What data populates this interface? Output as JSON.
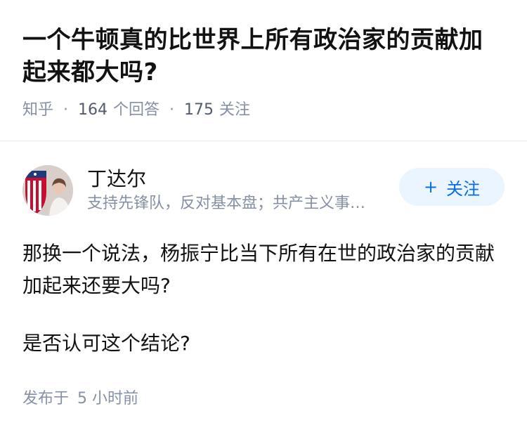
{
  "question": {
    "title": "一个牛顿真的比世界上所有政治家的贡献加起来都大吗?",
    "source": "知乎",
    "answer_count": "164",
    "answer_label": "个回答",
    "follow_count": "175",
    "follow_label": "关注"
  },
  "answer": {
    "author": {
      "name": "丁达尔",
      "bio": "支持先锋队，反对基本盘；共产主义事业的接班人"
    },
    "follow_button": {
      "icon": "plus-icon",
      "label": "关注"
    },
    "paragraphs": [
      "那换一个说法，杨振宁比当下所有在世的政治家的贡献加起来还要大吗?",
      "是否认可这个结论?"
    ],
    "posted_prefix": "发布于",
    "posted_time": "5 小时前"
  },
  "colors": {
    "accent": "#056de8",
    "follow_bg": "#ebf5ff",
    "meta_gray": "#8590a6",
    "text": "#121212"
  }
}
